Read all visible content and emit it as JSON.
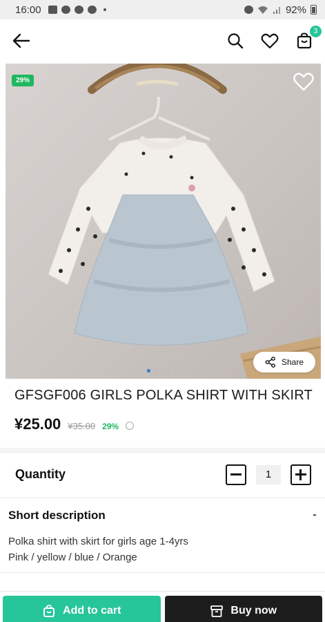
{
  "status_bar": {
    "time": "16:00",
    "battery": "92%",
    "icons": [
      "image-icon",
      "wechat-icon",
      "whatsapp-icon",
      "skype-icon",
      "alarm-icon",
      "wifi-icon",
      "signal-icon",
      "battery-icon"
    ]
  },
  "app_bar": {
    "back_icon": "arrow-left-icon",
    "actions": [
      "search-icon",
      "heart-icon",
      "cart-icon"
    ],
    "cart_count": "3"
  },
  "hero": {
    "discount_badge": "29%",
    "share_label": "Share",
    "carousel_count": 5,
    "carousel_active": 0
  },
  "product": {
    "title": "GFSGF006 GIRLS POLKA SHIRT WITH SKIRT",
    "price": "¥25.00",
    "old_price": "¥35.00",
    "discount": "29%"
  },
  "quantity": {
    "label": "Quantity",
    "value": "1"
  },
  "short_description": {
    "title": "Short description",
    "toggle": "-",
    "line1": "Polka shirt with skirt for girls age 1-4yrs",
    "line2": "Pink / yellow / blue / Orange"
  },
  "bottom_bar": {
    "add_to_cart": "Add to cart",
    "buy_now": "Buy now"
  },
  "colors": {
    "accent_green": "#27c59a",
    "badge_green": "#1fb85e",
    "buy_dark": "#1d1d1d"
  }
}
